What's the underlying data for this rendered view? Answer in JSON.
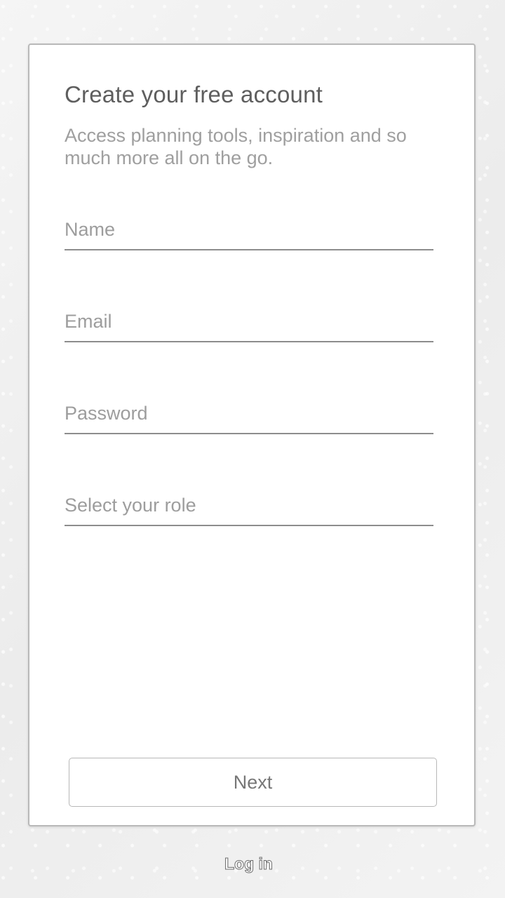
{
  "signup": {
    "title": "Create your free account",
    "subtitle": "Access planning tools, inspiration and so much more all on the go.",
    "fields": {
      "name_placeholder": "Name",
      "email_placeholder": "Email",
      "password_placeholder": "Password",
      "role_value": "Select your role"
    },
    "next_label": "Next",
    "login_label": "Log in"
  },
  "colors": {
    "background": "#f1f1f1",
    "card": "#ffffff",
    "text_primary": "#5e5e5e",
    "text_secondary": "#9f9f9f",
    "field_line": "#8d8d8d"
  }
}
